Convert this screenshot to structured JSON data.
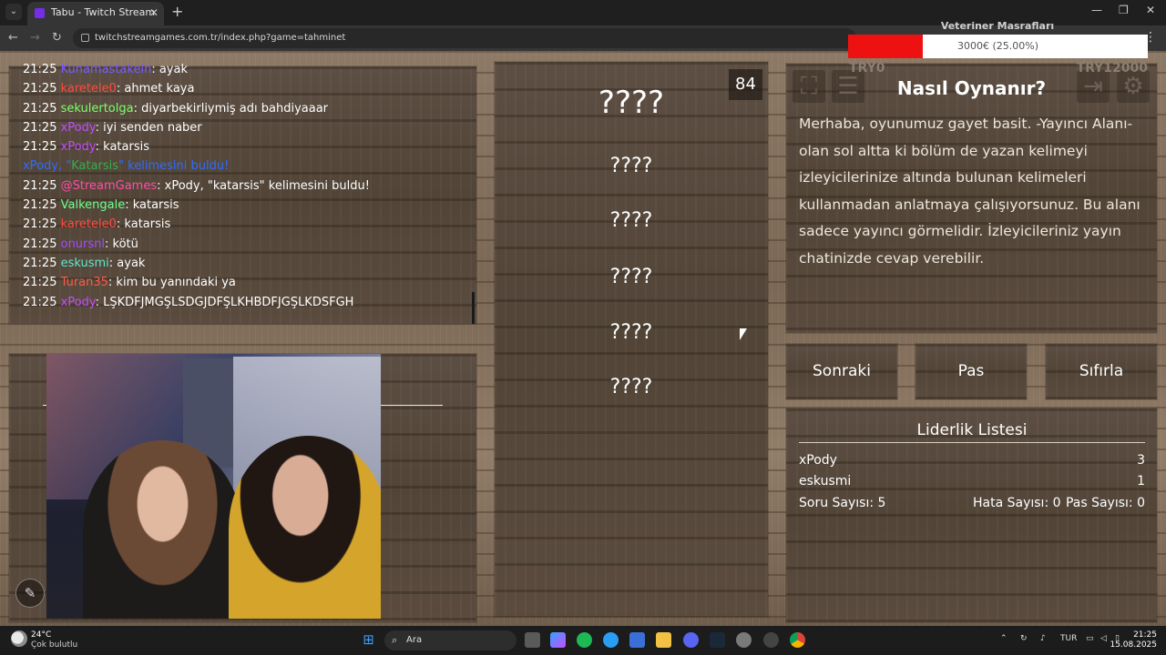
{
  "browser": {
    "tab_title": "Tabu - Twitch Stream Games",
    "url": "twitchstreamgames.com.tr/index.php?game=tahminet",
    "new_tab": "+",
    "close": "✕"
  },
  "chat": {
    "messages": [
      {
        "time": "21:25",
        "user": "Kunamastakein",
        "user_color": "#7a5cff",
        "text": ": ayak"
      },
      {
        "time": "21:25",
        "user": "karetele0",
        "user_color": "#ff4a3d",
        "text": ": ahmet kaya"
      },
      {
        "time": "21:25",
        "user": "sekulertolga",
        "user_color": "#7dff6b",
        "text": ": diyarbekirliymiş adı bahdiyaaar"
      },
      {
        "time": "21:25",
        "user": "xPody",
        "user_color": "#c34dff",
        "text": ": iyi senden naber"
      },
      {
        "time": "21:25",
        "user": "xPody",
        "user_color": "#c34dff",
        "text": ": katarsis"
      },
      {
        "time": "",
        "user": "",
        "user_color": "#ffffff",
        "text": ""
      },
      {
        "time": "21:25",
        "user": "@StreamGames",
        "user_color": "#ff4fa8",
        "text": ": xPody, \"katarsis\" kelimesini buldu!"
      },
      {
        "time": "21:25",
        "user": "Valkengale",
        "user_color": "#6bff8a",
        "text": ": katarsis"
      },
      {
        "time": "21:25",
        "user": "karetele0",
        "user_color": "#ff4a3d",
        "text": ": katarsis"
      },
      {
        "time": "21:25",
        "user": "onursnl",
        "user_color": "#a34dff",
        "text": ": kötü"
      },
      {
        "time": "21:25",
        "user": "eskusmi",
        "user_color": "#5fe8d0",
        "text": ": ayak"
      },
      {
        "time": "21:25",
        "user": "Turan35",
        "user_color": "#ff5a4a",
        "text": ": kim bu yanındaki ya"
      },
      {
        "time": "21:25",
        "user": "xPody",
        "user_color": "#c34dff",
        "text": ": LŞKDFJMGŞLSDGJDFŞLKHBDFJGŞLKDSFGH"
      }
    ],
    "system_message": {
      "part1": "xPody, \"",
      "word": "Katarsis",
      "part2": "\" kelimesini buldu!",
      "color": "#2f6cff",
      "word_color": "#33b24a"
    }
  },
  "game": {
    "timer": "84",
    "main_word": "????",
    "forbidden_words": [
      "????",
      "????",
      "????",
      "????",
      "????"
    ]
  },
  "info": {
    "title": "Nasıl Oynanır?",
    "text": "Merhaba, oyunumuz gayet basit. -Yayıncı Alanı- olan sol altta ki bölüm de yazan kelimeyi izleyicilerinize altında bulunan kelimeleri kullanmadan anlatmaya çalışıyorsunuz. Bu alanı sadece yayıncı görmelidir. İzleyicileriniz yayın chatinizde cevap verebilir."
  },
  "buttons": {
    "next": "Sonraki",
    "pass": "Pas",
    "reset": "Sıfırla"
  },
  "leaderboard": {
    "title": "Liderlik Listesi",
    "rows": [
      {
        "name": "xPody",
        "score": "3"
      },
      {
        "name": "eskusmi",
        "score": "1"
      }
    ],
    "questions": "Soru Sayısı: 5",
    "errors": "Hata Sayısı: 0",
    "passes": "Pas Sayısı: 0"
  },
  "donation": {
    "title": "Veteriner Masrafları",
    "amount": "3000€ (25.00%)",
    "progress": 0.25,
    "min": "TRY0",
    "max": "TRY12000",
    "fill_color": "#ee1111"
  },
  "taskbar": {
    "temp": "24°C",
    "weather": "Çok bulutlu",
    "search": "Ara",
    "lang": "TUR",
    "time": "21:25",
    "date": "15.08.2025"
  },
  "colors": {
    "text_light": "#ffffff",
    "panel": "#574a3d",
    "page_wood": "#8a7764"
  }
}
